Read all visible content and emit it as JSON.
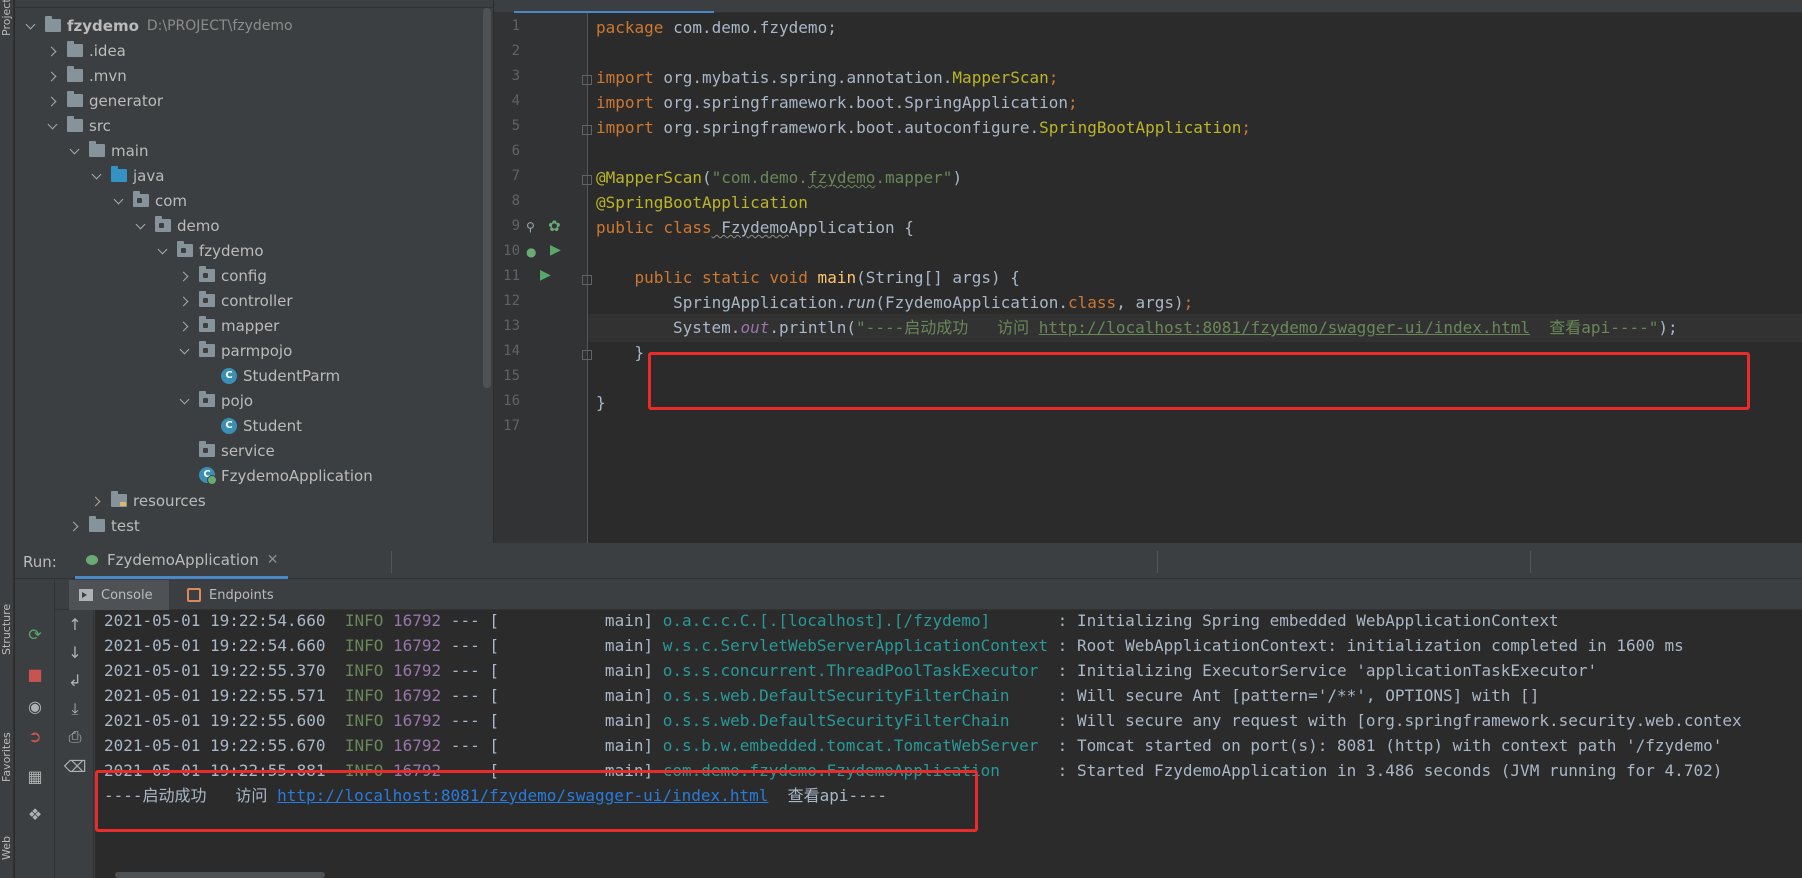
{
  "side_strip": {
    "project_label": "Project",
    "structure_label": "Structure",
    "favorites_label": "Favorites",
    "web_label": "Web"
  },
  "project_tree": {
    "root": {
      "name": "fzydemo",
      "path": "D:\\PROJECT\\fzydemo"
    },
    "items": [
      {
        "label": "idea_dir",
        "text": ".idea"
      },
      {
        "label": "mvn_dir",
        "text": ".mvn"
      },
      {
        "label": "generator_dir",
        "text": "generator"
      },
      {
        "label": "src_dir",
        "text": "src"
      },
      {
        "label": "main_dir",
        "text": "main"
      },
      {
        "label": "java_dir",
        "text": "java"
      },
      {
        "label": "com_pkg",
        "text": "com"
      },
      {
        "label": "demo_pkg",
        "text": "demo"
      },
      {
        "label": "fzydemo_pkg",
        "text": "fzydemo"
      },
      {
        "label": "config_pkg",
        "text": "config"
      },
      {
        "label": "controller_pkg",
        "text": "controller"
      },
      {
        "label": "mapper_pkg",
        "text": "mapper"
      },
      {
        "label": "parmpojo_pkg",
        "text": "parmpojo"
      },
      {
        "label": "studentparm_class",
        "text": "StudentParm"
      },
      {
        "label": "pojo_pkg",
        "text": "pojo"
      },
      {
        "label": "student_class",
        "text": "Student"
      },
      {
        "label": "service_pkg",
        "text": "service"
      },
      {
        "label": "app_class",
        "text": "FzydemoApplication"
      },
      {
        "label": "resources_dir",
        "text": "resources"
      },
      {
        "label": "test_dir",
        "text": "test"
      }
    ]
  },
  "editor": {
    "line_numbers": [
      "1",
      "2",
      "3",
      "4",
      "5",
      "6",
      "7",
      "8",
      "9",
      "10",
      "11",
      "12",
      "13",
      "14",
      "15",
      "16",
      "17"
    ],
    "code": {
      "l1_kw": "package",
      "l1_rest": " com.demo.fzydemo;",
      "l3_kw": "import",
      "l3_pkg": " org.mybatis.spring.annotation.",
      "l3_cls": "MapperScan",
      "l3_end": ";",
      "l4_kw": "import",
      "l4_rest": " org.springframework.boot.SpringApplication",
      "l4_end": ";",
      "l5_kw": "import",
      "l5_pkg": " org.springframework.boot.autoconfigure.",
      "l5_cls": "SpringBootApplication",
      "l5_end": ";",
      "l7_ann": "@MapperScan",
      "l7_open": "(",
      "l7_str1": "\"com.demo.",
      "l7_str2": "fzydemo",
      "l7_str3": ".mapper\"",
      "l7_close": ")",
      "l8_ann": "@SpringBootApplication",
      "l9_kw": "public class",
      "l9_cls": " Fzydemo",
      "l9_rest": "Application {",
      "l11_indent": "    ",
      "l11_kw": "public static void",
      "l11_fn": " main",
      "l11_rest": "(String[] args) {",
      "l12_pre": "        SpringApplication.",
      "l12_run": "run",
      "l12_mid": "(FzydemoApplication.",
      "l12_class": "class",
      "l12_end": ", args)",
      "l12_semi": ";",
      "l13_pre": "System.",
      "l13_out": "out",
      "l13_mid": ".println(",
      "l13_str1": "\"----启动成功   访问 ",
      "l13_url": "http://localhost:8081/fzydemo/swagger-ui/index.html",
      "l13_str2": "  查看api----\"",
      "l13_end": ");",
      "l14": "    }",
      "l16": "}"
    }
  },
  "run_panel": {
    "run_label": "Run:",
    "run_tab": "FzydemoApplication",
    "console_tab": "Console",
    "endpoints_tab": "Endpoints",
    "logs": [
      {
        "ts": "2021-05-01 19:22:54.660",
        "level": "INFO",
        "pid": "16792",
        "sep": " --- [           main] ",
        "logger": "o.a.c.c.C.[.[localhost].[/fzydemo]      ",
        "msg": " : Initializing Spring embedded WebApplicationContext"
      },
      {
        "ts": "2021-05-01 19:22:54.660",
        "level": "INFO",
        "pid": "16792",
        "sep": " --- [           main] ",
        "logger": "w.s.c.ServletWebServerApplicationContext",
        "msg": " : Root WebApplicationContext: initialization completed in 1600 ms"
      },
      {
        "ts": "2021-05-01 19:22:55.370",
        "level": "INFO",
        "pid": "16792",
        "sep": " --- [           main] ",
        "logger": "o.s.s.concurrent.ThreadPoolTaskExecutor ",
        "msg": " : Initializing ExecutorService 'applicationTaskExecutor'"
      },
      {
        "ts": "2021-05-01 19:22:55.571",
        "level": "INFO",
        "pid": "16792",
        "sep": " --- [           main] ",
        "logger": "o.s.s.web.DefaultSecurityFilterChain    ",
        "msg": " : Will secure Ant [pattern='/**', OPTIONS] with []"
      },
      {
        "ts": "2021-05-01 19:22:55.600",
        "level": "INFO",
        "pid": "16792",
        "sep": " --- [           main] ",
        "logger": "o.s.s.web.DefaultSecurityFilterChain    ",
        "msg": " : Will secure any request with [org.springframework.security.web.contex"
      },
      {
        "ts": "2021-05-01 19:22:55.670",
        "level": "INFO",
        "pid": "16792",
        "sep": " --- [           main] ",
        "logger": "o.s.b.w.embedded.tomcat.TomcatWebServer ",
        "msg": " : Tomcat started on port(s): 8081 (http) with context path '/fzydemo'"
      },
      {
        "ts": "2021-05-01 19:22:55.881",
        "level": "INFO",
        "pid": "16792",
        "sep": " --- [           main] ",
        "logger": "com.demo.fzydemo.FzydemoApplication     ",
        "msg": " : Started FzydemoApplication in 3.486 seconds (JVM running for 4.702)"
      }
    ],
    "output_prefix": "----启动成功   访问 ",
    "output_url": "http://localhost:8081/fzydemo/swagger-ui/index.html",
    "output_suffix": "  查看api----"
  },
  "colors": {
    "highlight_box": "#ea2b2b",
    "keyword": "#cc7832",
    "string": "#6a8759",
    "annotation": "#bbb529",
    "logger": "#299999",
    "console_link": "#287bde"
  }
}
